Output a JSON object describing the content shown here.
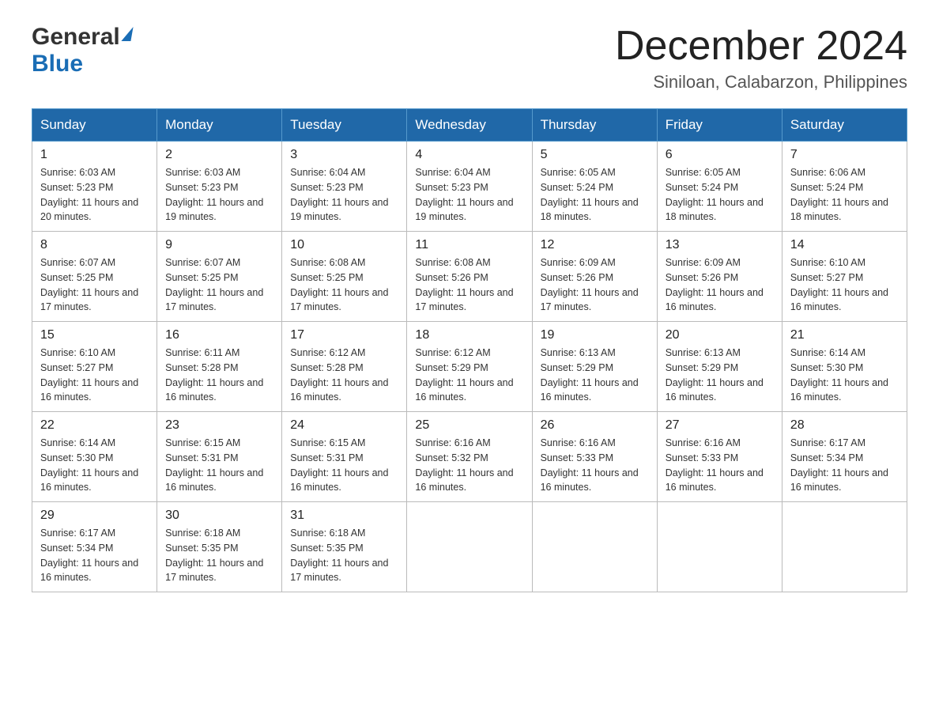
{
  "header": {
    "logo_general": "General",
    "logo_blue": "Blue",
    "month_title": "December 2024",
    "location": "Siniloan, Calabarzon, Philippines"
  },
  "weekdays": [
    "Sunday",
    "Monday",
    "Tuesday",
    "Wednesday",
    "Thursday",
    "Friday",
    "Saturday"
  ],
  "weeks": [
    [
      {
        "day": "1",
        "sunrise": "6:03 AM",
        "sunset": "5:23 PM",
        "daylight": "11 hours and 20 minutes."
      },
      {
        "day": "2",
        "sunrise": "6:03 AM",
        "sunset": "5:23 PM",
        "daylight": "11 hours and 19 minutes."
      },
      {
        "day": "3",
        "sunrise": "6:04 AM",
        "sunset": "5:23 PM",
        "daylight": "11 hours and 19 minutes."
      },
      {
        "day": "4",
        "sunrise": "6:04 AM",
        "sunset": "5:23 PM",
        "daylight": "11 hours and 19 minutes."
      },
      {
        "day": "5",
        "sunrise": "6:05 AM",
        "sunset": "5:24 PM",
        "daylight": "11 hours and 18 minutes."
      },
      {
        "day": "6",
        "sunrise": "6:05 AM",
        "sunset": "5:24 PM",
        "daylight": "11 hours and 18 minutes."
      },
      {
        "day": "7",
        "sunrise": "6:06 AM",
        "sunset": "5:24 PM",
        "daylight": "11 hours and 18 minutes."
      }
    ],
    [
      {
        "day": "8",
        "sunrise": "6:07 AM",
        "sunset": "5:25 PM",
        "daylight": "11 hours and 17 minutes."
      },
      {
        "day": "9",
        "sunrise": "6:07 AM",
        "sunset": "5:25 PM",
        "daylight": "11 hours and 17 minutes."
      },
      {
        "day": "10",
        "sunrise": "6:08 AM",
        "sunset": "5:25 PM",
        "daylight": "11 hours and 17 minutes."
      },
      {
        "day": "11",
        "sunrise": "6:08 AM",
        "sunset": "5:26 PM",
        "daylight": "11 hours and 17 minutes."
      },
      {
        "day": "12",
        "sunrise": "6:09 AM",
        "sunset": "5:26 PM",
        "daylight": "11 hours and 17 minutes."
      },
      {
        "day": "13",
        "sunrise": "6:09 AM",
        "sunset": "5:26 PM",
        "daylight": "11 hours and 16 minutes."
      },
      {
        "day": "14",
        "sunrise": "6:10 AM",
        "sunset": "5:27 PM",
        "daylight": "11 hours and 16 minutes."
      }
    ],
    [
      {
        "day": "15",
        "sunrise": "6:10 AM",
        "sunset": "5:27 PM",
        "daylight": "11 hours and 16 minutes."
      },
      {
        "day": "16",
        "sunrise": "6:11 AM",
        "sunset": "5:28 PM",
        "daylight": "11 hours and 16 minutes."
      },
      {
        "day": "17",
        "sunrise": "6:12 AM",
        "sunset": "5:28 PM",
        "daylight": "11 hours and 16 minutes."
      },
      {
        "day": "18",
        "sunrise": "6:12 AM",
        "sunset": "5:29 PM",
        "daylight": "11 hours and 16 minutes."
      },
      {
        "day": "19",
        "sunrise": "6:13 AM",
        "sunset": "5:29 PM",
        "daylight": "11 hours and 16 minutes."
      },
      {
        "day": "20",
        "sunrise": "6:13 AM",
        "sunset": "5:29 PM",
        "daylight": "11 hours and 16 minutes."
      },
      {
        "day": "21",
        "sunrise": "6:14 AM",
        "sunset": "5:30 PM",
        "daylight": "11 hours and 16 minutes."
      }
    ],
    [
      {
        "day": "22",
        "sunrise": "6:14 AM",
        "sunset": "5:30 PM",
        "daylight": "11 hours and 16 minutes."
      },
      {
        "day": "23",
        "sunrise": "6:15 AM",
        "sunset": "5:31 PM",
        "daylight": "11 hours and 16 minutes."
      },
      {
        "day": "24",
        "sunrise": "6:15 AM",
        "sunset": "5:31 PM",
        "daylight": "11 hours and 16 minutes."
      },
      {
        "day": "25",
        "sunrise": "6:16 AM",
        "sunset": "5:32 PM",
        "daylight": "11 hours and 16 minutes."
      },
      {
        "day": "26",
        "sunrise": "6:16 AM",
        "sunset": "5:33 PM",
        "daylight": "11 hours and 16 minutes."
      },
      {
        "day": "27",
        "sunrise": "6:16 AM",
        "sunset": "5:33 PM",
        "daylight": "11 hours and 16 minutes."
      },
      {
        "day": "28",
        "sunrise": "6:17 AM",
        "sunset": "5:34 PM",
        "daylight": "11 hours and 16 minutes."
      }
    ],
    [
      {
        "day": "29",
        "sunrise": "6:17 AM",
        "sunset": "5:34 PM",
        "daylight": "11 hours and 16 minutes."
      },
      {
        "day": "30",
        "sunrise": "6:18 AM",
        "sunset": "5:35 PM",
        "daylight": "11 hours and 17 minutes."
      },
      {
        "day": "31",
        "sunrise": "6:18 AM",
        "sunset": "5:35 PM",
        "daylight": "11 hours and 17 minutes."
      },
      null,
      null,
      null,
      null
    ]
  ]
}
